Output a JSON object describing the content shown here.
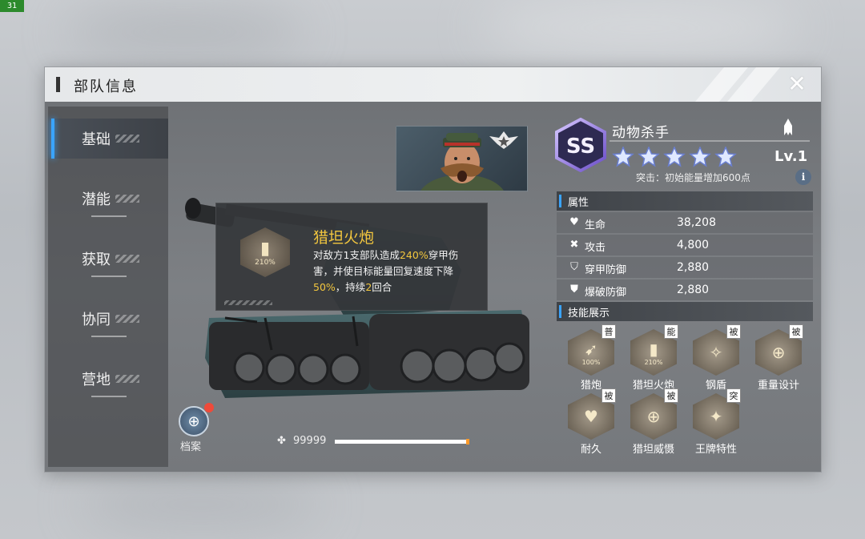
{
  "corner_badge": "31",
  "window": {
    "title": "部队信息",
    "close_glyph": "✕"
  },
  "sidebar": {
    "items": [
      {
        "label": "基础",
        "active": true
      },
      {
        "label": "潜能",
        "active": false
      },
      {
        "label": "获取",
        "active": false
      },
      {
        "label": "协同",
        "active": false
      },
      {
        "label": "营地",
        "active": false
      }
    ]
  },
  "archive": {
    "label": "档案"
  },
  "exp": {
    "value": "99999",
    "fill_fraction": 0.99
  },
  "tooltip": {
    "title": "猎坦火炮",
    "icon_pct": "210%",
    "desc_1": "对敌方1支部队造成",
    "desc_hl1": "240%",
    "desc_2": "穿甲伤害，并使目标能量回复速度下降",
    "desc_hl2": "50%",
    "desc_3": "，持续",
    "desc_hl3": "2",
    "desc_4": "回合"
  },
  "unit": {
    "rank": "SS",
    "name": "动物杀手",
    "stars": 5,
    "level": "Lv.1",
    "breakthrough": "突击：初始能量增加600点"
  },
  "attributes": {
    "header": "属性",
    "rows": [
      {
        "icon": "heart-icon",
        "label": "生命",
        "value": "38,208"
      },
      {
        "icon": "attack-icon",
        "label": "攻击",
        "value": "4,800"
      },
      {
        "icon": "armor-shield-icon",
        "label": "穿甲防御",
        "value": "2,880"
      },
      {
        "icon": "blast-shield-icon",
        "label": "爆破防御",
        "value": "2,880"
      }
    ]
  },
  "skills": {
    "header": "技能展示",
    "items": [
      {
        "name": "猎炮",
        "tag": "普",
        "pct": "100%"
      },
      {
        "name": "猎坦火炮",
        "tag": "能",
        "pct": "210%"
      },
      {
        "name": "钢盾",
        "tag": "被",
        "pct": ""
      },
      {
        "name": "重量设计",
        "tag": "被",
        "pct": ""
      },
      {
        "name": "耐久",
        "tag": "被",
        "pct": ""
      },
      {
        "name": "猎坦威慑",
        "tag": "被",
        "pct": ""
      },
      {
        "name": "王牌特性",
        "tag": "突",
        "pct": ""
      }
    ]
  },
  "colors": {
    "accent": "#3aa4ff",
    "highlight": "#f2c63e",
    "alert": "#ef4a3a"
  }
}
